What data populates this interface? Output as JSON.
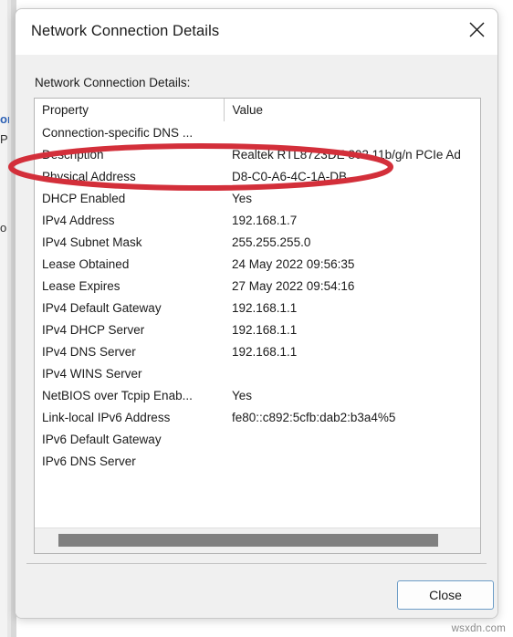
{
  "background": {
    "fragment_link": "or",
    "fragment_p": "P",
    "fragment_o": "o"
  },
  "dialog": {
    "title": "Network Connection Details",
    "close_icon": "close-x-icon",
    "section_label": "Network Connection Details:",
    "close_button_label": "Close"
  },
  "table": {
    "headers": {
      "property": "Property",
      "value": "Value"
    },
    "rows": [
      {
        "property": "Connection-specific DNS ...",
        "value": ""
      },
      {
        "property": "Description",
        "value": "Realtek RTL8723DE 802.11b/g/n PCIe Ad"
      },
      {
        "property": "Physical Address",
        "value": "D8-C0-A6-4C-1A-DB"
      },
      {
        "property": "DHCP Enabled",
        "value": "Yes"
      },
      {
        "property": "IPv4 Address",
        "value": "192.168.1.7"
      },
      {
        "property": "IPv4 Subnet Mask",
        "value": "255.255.255.0"
      },
      {
        "property": "Lease Obtained",
        "value": "24 May 2022 09:56:35"
      },
      {
        "property": "Lease Expires",
        "value": "27 May 2022 09:54:16"
      },
      {
        "property": "IPv4 Default Gateway",
        "value": "192.168.1.1"
      },
      {
        "property": "IPv4 DHCP Server",
        "value": "192.168.1.1"
      },
      {
        "property": "IPv4 DNS Server",
        "value": "192.168.1.1"
      },
      {
        "property": "IPv4 WINS Server",
        "value": ""
      },
      {
        "property": "NetBIOS over Tcpip Enab...",
        "value": "Yes"
      },
      {
        "property": "Link-local IPv6 Address",
        "value": "fe80::c892:5cfb:dab2:b3a4%5"
      },
      {
        "property": "IPv6 Default Gateway",
        "value": ""
      },
      {
        "property": "IPv6 DNS Server",
        "value": ""
      }
    ]
  },
  "scrollbar": {
    "orientation": "horizontal",
    "left_arrow_icon": "chevron-left-icon",
    "right_arrow_icon": "chevron-right-icon"
  },
  "annotation": {
    "shape": "ellipse",
    "color": "#D32F3A",
    "highlights": "Physical Address"
  },
  "watermark": {
    "text": "wsxdn.com"
  }
}
